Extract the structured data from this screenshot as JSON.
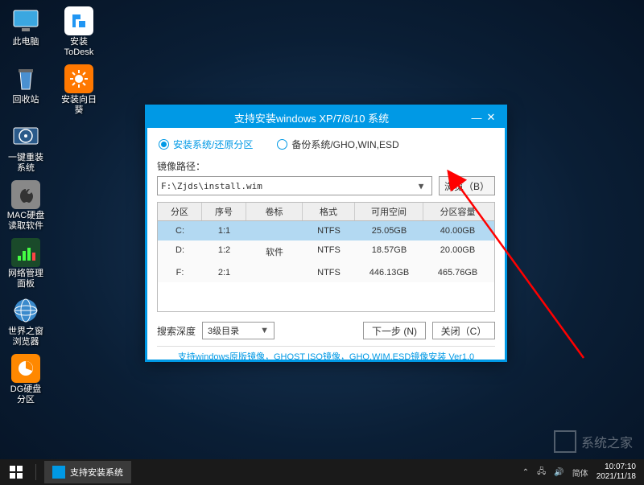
{
  "desktop_icons": {
    "r0": {
      "a": "此电脑",
      "b": "安装ToDesk"
    },
    "r1": {
      "a": "回收站",
      "b": "安装向日葵"
    },
    "r2": {
      "a": "一键重装系统"
    },
    "r3": {
      "a": "MAC硬盘读取软件"
    },
    "r4": {
      "a": "网络管理面板"
    },
    "r5": {
      "a": "世界之窗浏览器"
    },
    "r6": {
      "a": "DG硬盘分区"
    }
  },
  "window": {
    "title": "支持安装windows XP/7/8/10 系统",
    "radio1": "安装系统/还原分区",
    "radio2": "备份系统/GHO,WIN,ESD",
    "path_label": "镜像路径：",
    "path_value": "F:\\Zjds\\install.wim",
    "browse": "浏览（B）",
    "cols": {
      "c0": "分区",
      "c1": "序号",
      "c2": "卷标",
      "c3": "格式",
      "c4": "可用空间",
      "c5": "分区容量"
    },
    "rows": [
      {
        "c0": "C:",
        "c1": "1:1",
        "c2": "",
        "c3": "NTFS",
        "c4": "25.05GB",
        "c5": "40.00GB"
      },
      {
        "c0": "D:",
        "c1": "1:2",
        "c2": "软件",
        "c3": "NTFS",
        "c4": "18.57GB",
        "c5": "20.00GB"
      },
      {
        "c0": "F:",
        "c1": "2:1",
        "c2": "",
        "c3": "NTFS",
        "c4": "446.13GB",
        "c5": "465.76GB"
      }
    ],
    "depth_label": "搜索深度",
    "depth_value": "3级目录",
    "next": "下一步 (N)",
    "close": "关闭（C）",
    "info": "支持windows原版镜像，GHOST ISO镜像，GHO,WIM,ESD镜像安装 Ver1.0"
  },
  "taskbar": {
    "item1": "支持安装系统",
    "ime": "简体",
    "time": "10:07:10",
    "date": "2021/11/18"
  },
  "watermark": "系统之家"
}
